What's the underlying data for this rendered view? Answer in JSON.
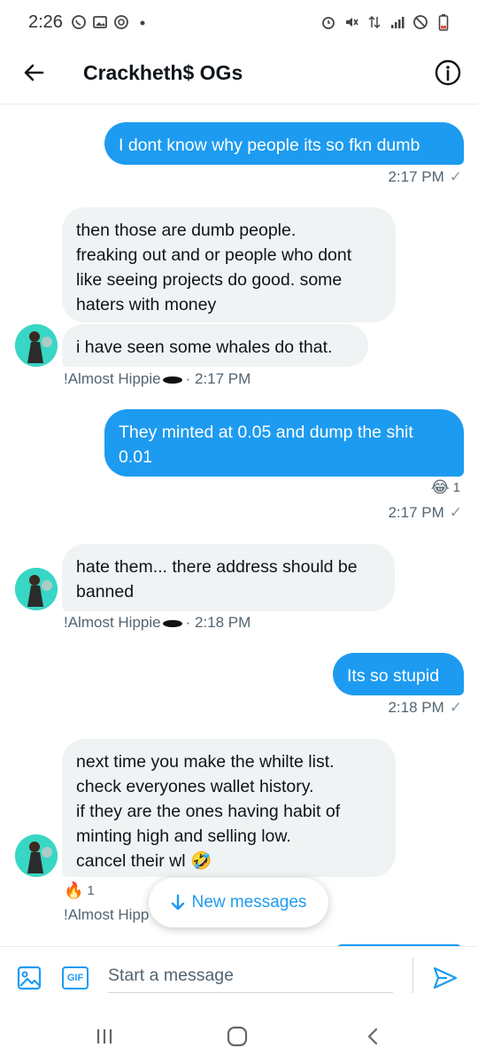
{
  "status_bar": {
    "time": "2:26",
    "left_icons": [
      "whatsapp-icon",
      "gallery-icon",
      "sync-icon",
      "dot-icon"
    ],
    "right_icons": [
      "alarm-icon",
      "mute-icon",
      "data-icon",
      "signal-icon",
      "dnd-icon",
      "battery-icon"
    ]
  },
  "header": {
    "title": "Crackheth$ OGs"
  },
  "messages": [
    {
      "dir": "out",
      "text": "I dont know why people its so fkn dumb",
      "time": "2:17 PM"
    },
    {
      "dir": "in",
      "text": "then those are dumb people.\nfreaking out and or people who dont like seeing projects do good. some haters with money"
    },
    {
      "dir": "in",
      "text": "i have seen some whales do that.",
      "sender": "!Almost Hippie",
      "time": "· 2:17 PM"
    },
    {
      "dir": "out",
      "text": "They minted at 0.05 and dump the shit 0.01",
      "reaction": "😂",
      "reaction_count": "1",
      "time": "2:17 PM"
    },
    {
      "dir": "in",
      "text": "hate them... there address should be banned",
      "sender": "!Almost Hippie",
      "time": "· 2:18 PM"
    },
    {
      "dir": "out",
      "text": "Its so stupid",
      "time": "2:18 PM"
    },
    {
      "dir": "in",
      "text": "next time you make the whilte list.\ncheck everyones wallet history.\nif they are the ones having habit of minting high and selling low.\ncancel their wl 🤣",
      "reaction": "🔥",
      "reaction_count": "1",
      "sender": "!Almost Hipp"
    }
  ],
  "new_messages_label": "New messages",
  "composer": {
    "placeholder": "Start a message",
    "gif_label": "GIF"
  },
  "colors": {
    "accent": "#1d9bf0",
    "incoming_bubble": "#eff3f4",
    "avatar_bg": "#38d6c4"
  }
}
